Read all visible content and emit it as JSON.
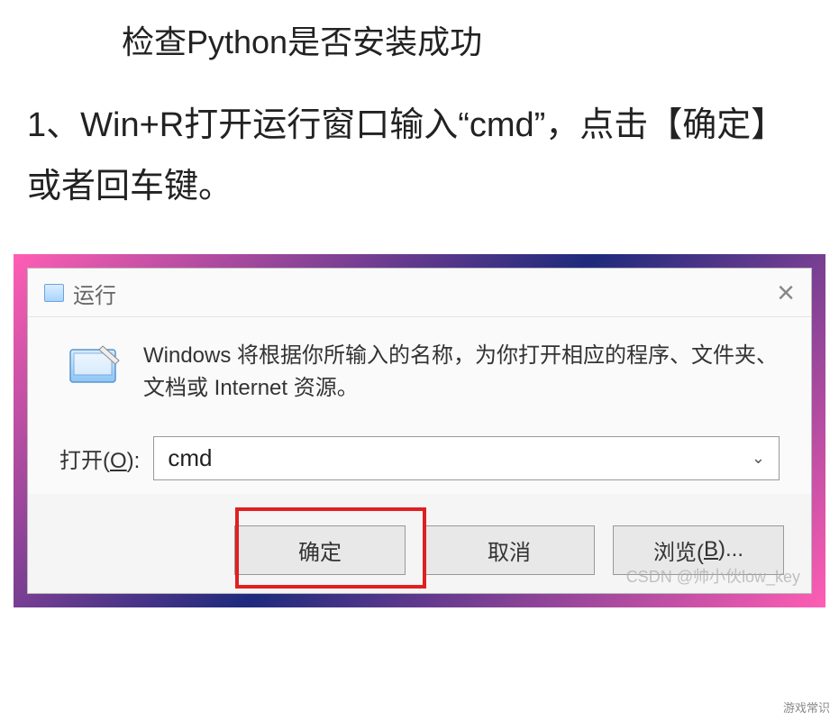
{
  "article": {
    "heading": "检查Python是否安装成功",
    "step1": "1、Win+R打开运行窗口输入“cmd”，点击【确定】或者回车键。"
  },
  "dialog": {
    "title": "运行",
    "description": "Windows 将根据你所输入的名称，为你打开相应的程序、文件夹、文档或 Internet 资源。",
    "open_label_prefix": "打开(",
    "open_label_key": "O",
    "open_label_suffix": "):",
    "input_value": "cmd",
    "ok_button": "确定",
    "cancel_button": "取消",
    "browse_button_prefix": "浏览(",
    "browse_button_key": "B",
    "browse_button_suffix": ")..."
  },
  "watermark": "CSDN @帅小伙low_key",
  "footer": "游戏常识"
}
